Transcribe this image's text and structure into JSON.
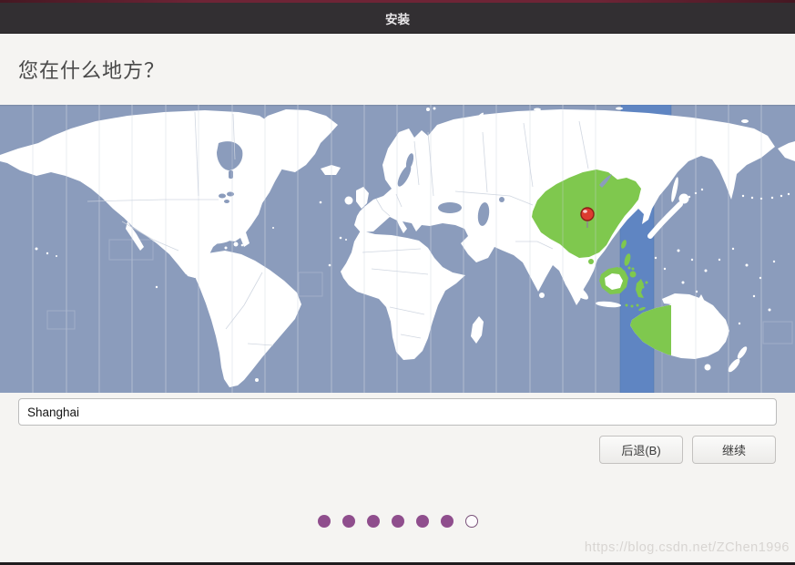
{
  "titlebar": {
    "title": "安装"
  },
  "heading": "您在什么地方？",
  "location_input": {
    "value": "Shanghai"
  },
  "actions": {
    "back_label": "后退(B)",
    "continue_label": "继续"
  },
  "progress": {
    "total_steps": 7,
    "completed_steps": 6
  },
  "watermark": "https://blog.csdn.net/ZChen1996",
  "colors": {
    "titlebar-bg": "#322f32",
    "page-bg": "#f5f4f2",
    "ocean": "#8b9cbc",
    "zone-line": "#c9d0de",
    "highlight-zone": "#5f85c2",
    "land": "#ffffff",
    "land-border": "#ccd3de",
    "selected-region": "#7fc84e",
    "pin-red": "#dd3b30",
    "accent-purple": "#8f4e8d",
    "button-border": "#c3c1bf"
  }
}
